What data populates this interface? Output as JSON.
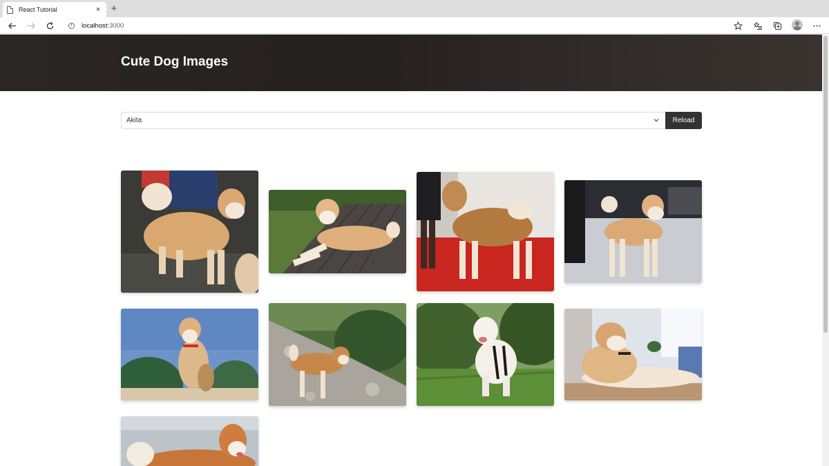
{
  "browser": {
    "tab_title": "React Tutorial",
    "tab_close": "×",
    "new_tab": "+",
    "url_host": "localhost",
    "url_port": ":3000"
  },
  "page": {
    "title": "Cute Dog Images"
  },
  "form": {
    "selected_breed": "Akita",
    "reload_label": "Reload"
  },
  "gallery": {
    "images": [
      {
        "alt": "akita-1"
      },
      {
        "alt": "akita-2"
      },
      {
        "alt": "akita-3"
      },
      {
        "alt": "akita-4"
      },
      {
        "alt": "akita-5"
      },
      {
        "alt": "akita-6"
      },
      {
        "alt": "akita-7"
      },
      {
        "alt": "akita-8"
      },
      {
        "alt": "akita-9"
      }
    ]
  },
  "colors": {
    "hero_bg": "#2b2626",
    "button_bg": "#333333",
    "chevron": "#2e6da4"
  }
}
